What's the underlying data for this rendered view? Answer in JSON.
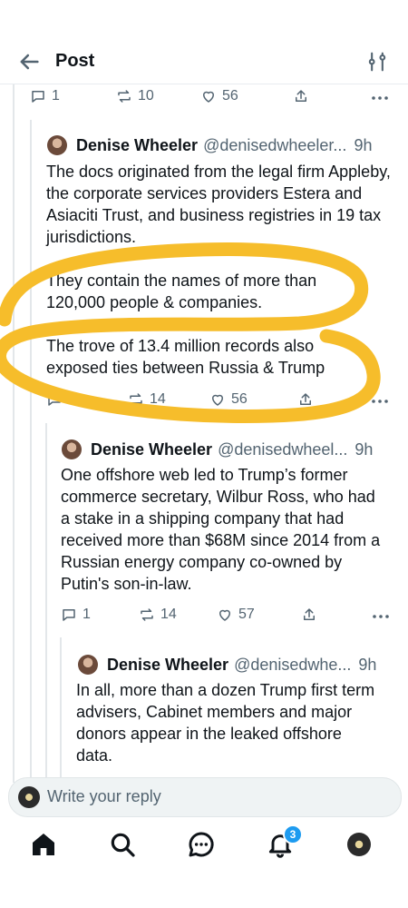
{
  "header": {
    "title": "Post",
    "back_icon": "arrow-left-icon",
    "filter_icon": "sliders-icon"
  },
  "top_actions": {
    "replies": "1",
    "reposts": "10",
    "likes": "56"
  },
  "tweets": [
    {
      "author": "Denise Wheeler",
      "handle": "@denisedwheeler...",
      "time": "9h",
      "paragraphs": [
        "The docs originated from the legal firm Appleby, the corporate services providers Estera and Asiaciti Trust, and business registries in 19 tax jurisdictions.",
        "They contain the names of more than 120,000 people & companies.",
        "The trove of 13.4 million records also exposed ties between Russia & Trump"
      ],
      "replies": "",
      "reposts": "14",
      "likes": "56"
    },
    {
      "author": "Denise Wheeler",
      "handle": "@denisedwheel...",
      "time": "9h",
      "paragraphs": [
        "One offshore web led to Trump’s former commerce secretary, Wilbur Ross, who had a stake in a shipping company that had received more than $68M since 2014 from a Russian energy company co-owned by Putin's son-in-law."
      ],
      "replies": "1",
      "reposts": "14",
      "likes": "57"
    },
    {
      "author": "Denise Wheeler",
      "handle": "@denisedwhe...",
      "time": "9h",
      "paragraphs": [
        "In all, more than a dozen Trump first term advisers, Cabinet members and major donors appear in the leaked offshore data."
      ]
    }
  ],
  "reply_bar": {
    "placeholder": "Write your reply"
  },
  "bottom_nav": {
    "notification_badge": "3"
  },
  "colors": {
    "accent": "#1d9bf0",
    "highlight": "#f6bd2b",
    "muted": "#536471"
  }
}
